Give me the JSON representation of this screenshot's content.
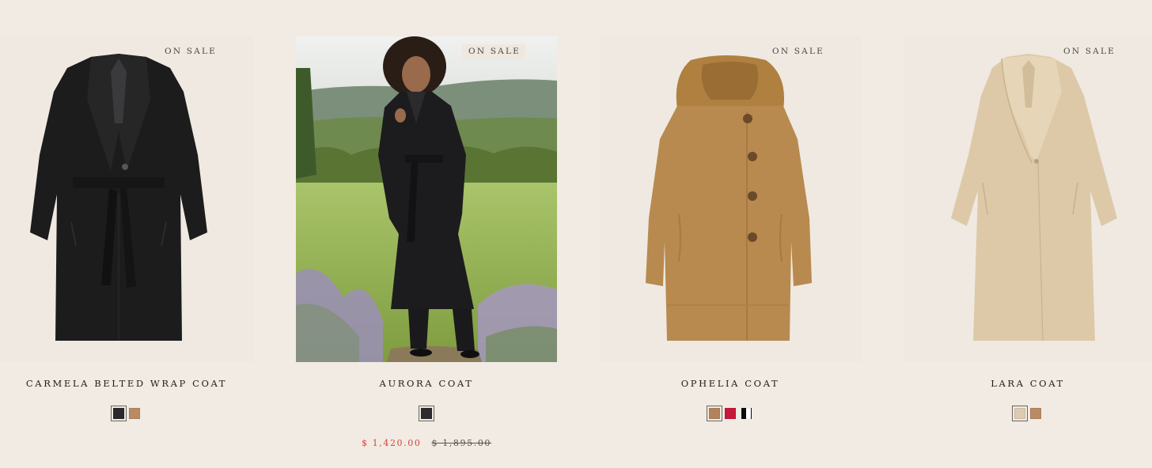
{
  "products": [
    {
      "badge": "ON SALE",
      "title": "CARMELA BELTED WRAP COAT",
      "swatches": [
        {
          "color": "#2a2a2c",
          "selected": true
        },
        {
          "color": "#b98a64",
          "selected": false
        }
      ]
    },
    {
      "badge": "ON SALE",
      "title": "AURORA COAT",
      "swatches": [
        {
          "color": "#2d2a30",
          "selected": true
        }
      ],
      "sale_price": "$ 1,420.00",
      "original_price": "$ 1,895.00"
    },
    {
      "badge": "ON SALE",
      "title": "OPHELIA COAT",
      "swatches": [
        {
          "color": "#b3835c",
          "selected": true
        },
        {
          "color": "#c8183a",
          "selected": false
        },
        {
          "color": "#0d0d0d",
          "selected": false
        }
      ]
    },
    {
      "badge": "ON SALE",
      "title": "LARA COAT",
      "swatches": [
        {
          "color": "#dccab1",
          "selected": true
        },
        {
          "color": "#b98a64",
          "selected": false
        }
      ]
    }
  ],
  "colors": {
    "background": "#f1ebe3",
    "sale_price": "#d9413a",
    "black_coat": "#1c1c1c",
    "camel_coat": "#b88a4f",
    "beige_coat": "#ddc9a8"
  }
}
